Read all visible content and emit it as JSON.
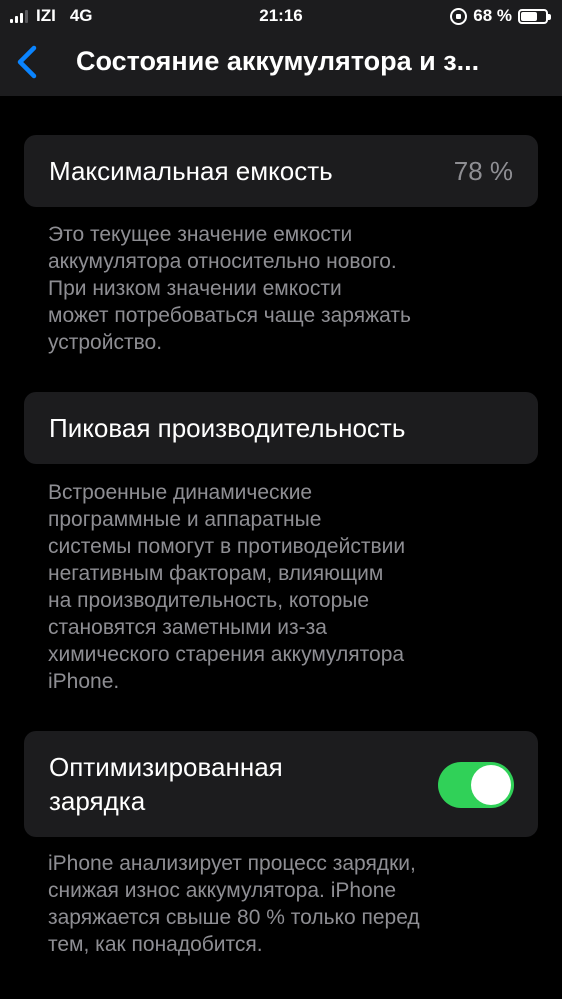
{
  "status_bar": {
    "carrier": "IZI",
    "network": "4G",
    "time": "21:16",
    "battery_percent": "68 %",
    "battery_level": 0.68,
    "icons": [
      "signal-icon",
      "rotation-lock-icon",
      "battery-icon"
    ]
  },
  "nav": {
    "back_icon": "chevron-left-icon",
    "title": "Состояние аккумулятора и з..."
  },
  "max_capacity": {
    "label": "Максимальная емкость",
    "value": "78 %",
    "footnote": "Это текущее значение емкости\nаккумулятора относительно нового.\nПри низком значении емкости\nможет потребоваться чаще заряжать\nустройство."
  },
  "peak_performance": {
    "label": "Пиковая производительность",
    "footnote": "Встроенные динамические\nпрограммные и аппаратные\nсистемы помогут в противодействии\nнегативным факторам, влияющим\nна производительность, которые\nстановятся заметными из-за\nхимического старения аккумулятора\niPhone."
  },
  "optimized_charging": {
    "label": "Оптимизированная\nзарядка",
    "enabled": true,
    "footnote": "iPhone анализирует процесс зарядки,\nснижая износ аккумулятора. iPhone\nзаряжается свыше 80 % только перед\nтем, как понадобится."
  },
  "colors": {
    "background": "#000000",
    "card": "#1c1c1e",
    "accent": "#0a84ff",
    "toggle_on": "#30d158",
    "secondary_text": "#8e8e93"
  }
}
